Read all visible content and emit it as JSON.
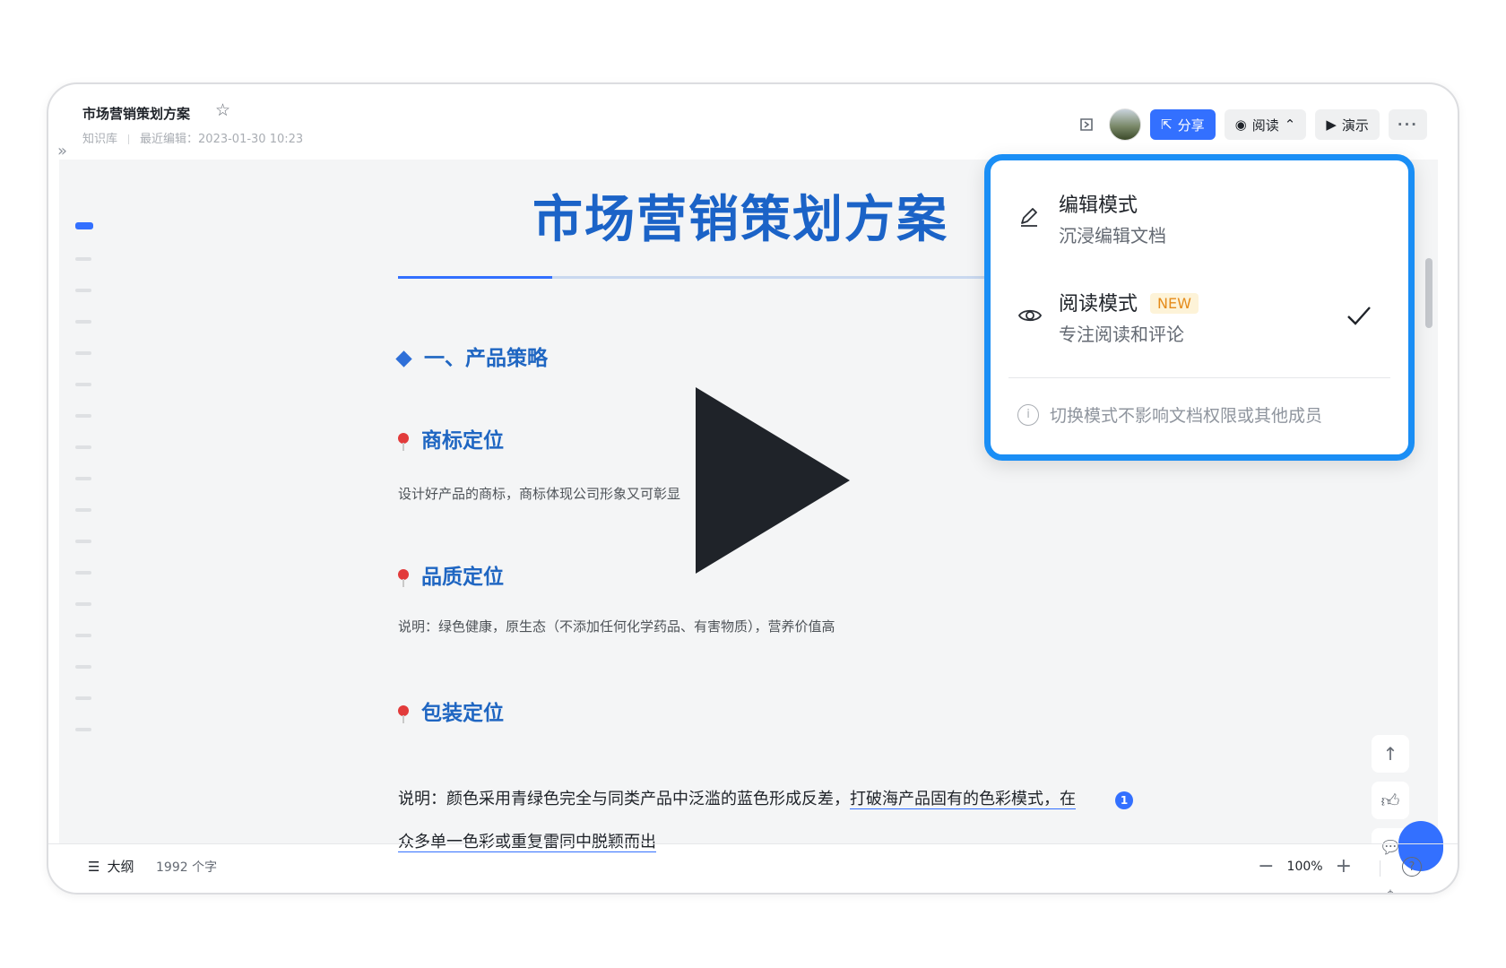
{
  "header": {
    "title": "市场营销策划方案",
    "breadcrumb": "知识库",
    "last_edited_label": "最近编辑：",
    "last_edited_time": "2023-01-30 10:23"
  },
  "toolbar": {
    "share_label": "分享",
    "read_label": "阅读",
    "present_label": "演示",
    "more_label": "···"
  },
  "document": {
    "title": "市场营销策划方案",
    "section_1": "一、产品策略",
    "brand_heading": "商标定位",
    "brand_text": "设计好产品的商标，商标体现公司形象又可彰显",
    "quality_heading": "品质定位",
    "quality_text": "说明：绿色健康，原生态（不添加任何化学药品、有害物质），营养价值高",
    "package_heading": "包装定位",
    "package_text_a": "说明：颜色采用青绿色完全与同类产品中泛滥的蓝色形成反差，",
    "package_text_b": "打破海产品固有的色彩模式，在众多单一色彩或重复雷同中脱颖而出",
    "comment_count": "1"
  },
  "dropdown": {
    "edit_mode_name": "编辑模式",
    "edit_mode_desc": "沉浸编辑文档",
    "read_mode_name": "阅读模式",
    "read_mode_badge": "NEW",
    "read_mode_desc": "专注阅读和评论",
    "note": "切换模式不影响文档权限或其他成员",
    "selected": "阅读模式"
  },
  "footer": {
    "outline_label": "大纲",
    "word_count": "1992 个字",
    "zoom": "100%"
  },
  "colors": {
    "accent": "#3370ff",
    "title_blue": "#1b63c7",
    "highlight_border": "#1a8ef5"
  }
}
